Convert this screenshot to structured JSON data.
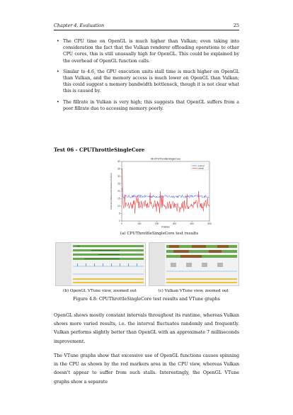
{
  "header": {
    "chapter": "Chapter 4.  Evaluation",
    "page_number": "25"
  },
  "bullets": [
    "The CPU time on OpenGL is much higher than Vulkan; even taking into consideration the fact that the Vulkan renderer offloading operations to other CPU cores, this is still unusually high for OpenGL. This could be explained by the overhead of OpenGL function calls.",
    "Similar to 4.6, the GPU execution units stall time is much higher on OpenGL than Vulkan, and the memory access is much lower on OpenGL than Vulkan; this could suggest a memory bandwidth bottleneck, though it is not clear what this is caused by.",
    "The fillrate in Vulkan is very high; this suggests that OpenGL suffers from a poor fillrate due to accessing memory poorly."
  ],
  "section_title": "Test 06 - CPUThrottleSingleCore",
  "chart_data": {
    "type": "line",
    "title": "06 CPUThrottleSingleCore",
    "xlabel": "Frames",
    "ylabel": "Interval (milliseconds between frames)",
    "xlim": [
      0,
      500
    ],
    "ylim": [
      0,
      40
    ],
    "xticks": [
      0,
      100,
      200,
      300,
      400,
      500
    ],
    "yticks": [
      0,
      5,
      10,
      15,
      20,
      25,
      30,
      35,
      40
    ],
    "legend_position": "top-right",
    "series": [
      {
        "name": "opengl",
        "color": "#2b3fd6",
        "baseline": 16.5,
        "spread": 1.0,
        "start_spike": 22
      },
      {
        "name": "vulkan",
        "color": "#e01818",
        "baseline": 11,
        "spread": 3.0,
        "start_spike": 35
      }
    ]
  },
  "subcaption_a": "(a) CPUThrottleSingleCore test results",
  "subcaption_b": "(b) OpenGL VTune view, zoomed out",
  "subcaption_c": "(c) Vulkan VTune view, zoomed out",
  "figure_caption": "Figure 4.8: CPUThrottleSingleCore test results and VTune graphs",
  "paragraphs": [
    "OpenGL shows mostly constant intervals throughout its runtime, whereas Vulkan shows more varied results, i.e. the interval fluctuates randomly and frequently. Vulkan performs slightly better than OpenGL with an approximate 7 milliseconds improvement.",
    "The VTune graphs show that excessive use of OpenGL functions causes spinning in the CPU as shown by the red markers area in the CPU view, whereas Vulkan doesn't appear to suffer from such stalls. Interestingly, the OpenGL VTune graphs show a separate"
  ]
}
